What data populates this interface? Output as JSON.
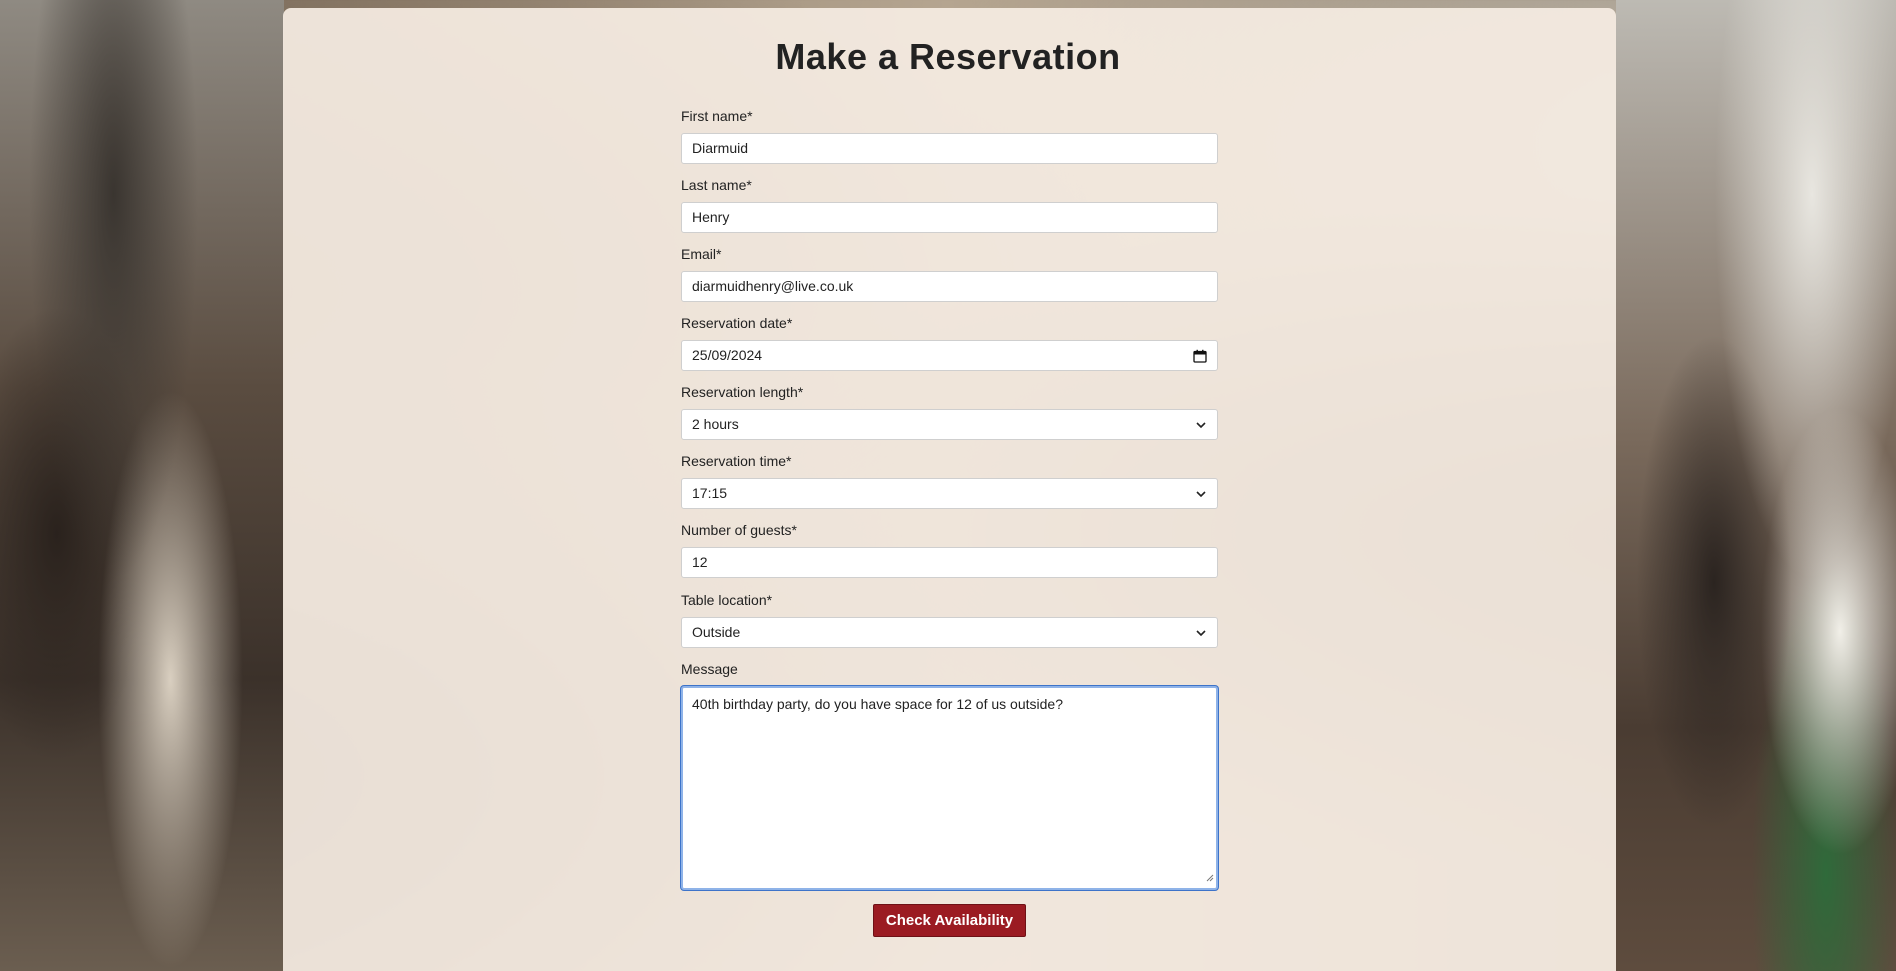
{
  "page": {
    "title": "Make a Reservation"
  },
  "form": {
    "first_name": {
      "label": "First name*",
      "value": "Diarmuid"
    },
    "last_name": {
      "label": "Last name*",
      "value": "Henry"
    },
    "email": {
      "label": "Email*",
      "value": "diarmuidhenry@live.co.uk"
    },
    "reservation_date": {
      "label": "Reservation date*",
      "value": "25/09/2024",
      "icon": "calendar-icon"
    },
    "reservation_length": {
      "label": "Reservation length*",
      "value": "2 hours",
      "icon": "chevron-down-icon"
    },
    "reservation_time": {
      "label": "Reservation time*",
      "value": "17:15",
      "icon": "chevron-down-icon"
    },
    "guests": {
      "label": "Number of guests*",
      "value": "12"
    },
    "table_location": {
      "label": "Table location*",
      "value": "Outside",
      "icon": "chevron-down-icon"
    },
    "message": {
      "label": "Message",
      "value": "40th birthday party, do you have space for 12 of us outside?"
    },
    "submit_label": "Check Availability"
  },
  "colors": {
    "button": "#9b1b22",
    "panel": "#f5ece2",
    "focus_ring": "#3d73c9"
  }
}
